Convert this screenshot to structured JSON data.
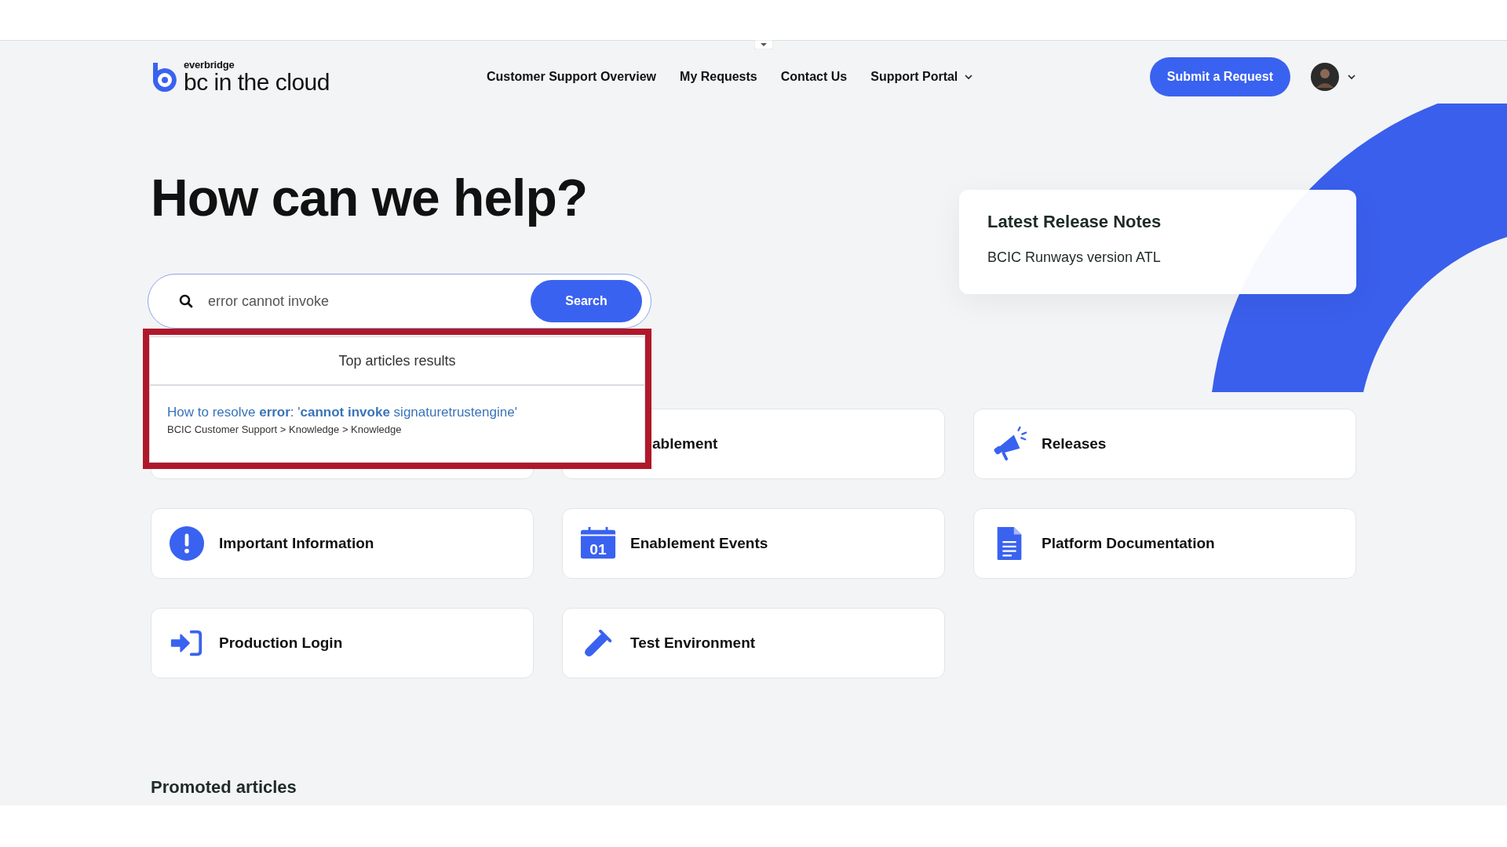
{
  "header": {
    "logo": {
      "brand": "everbridge",
      "name": "bc in the cloud"
    },
    "nav": [
      {
        "label": "Customer Support Overview",
        "dropdown": false
      },
      {
        "label": "My Requests",
        "dropdown": false
      },
      {
        "label": "Contact Us",
        "dropdown": false
      },
      {
        "label": "Support Portal",
        "dropdown": true
      }
    ],
    "cta": "Submit a Request"
  },
  "hero": {
    "heading": "How can we help?",
    "search": {
      "value": "error cannot invoke",
      "button": "Search"
    },
    "results": {
      "heading": "Top articles results",
      "items": [
        {
          "title": "How to resolve **error**: '**cannot invoke** signaturetrustengine'",
          "path": "BCIC Customer Support > Knowledge > Knowledge"
        }
      ]
    }
  },
  "release_notes": {
    "title": "Latest Release Notes",
    "items": [
      "BCIC Runways version ATL"
    ]
  },
  "cards": [
    {
      "kind": "covered"
    },
    {
      "kind": "partial",
      "label": "ablement"
    },
    {
      "kind": "full",
      "label": "Releases"
    },
    {
      "kind": "full",
      "label": "Important Information"
    },
    {
      "kind": "full",
      "label": "Enablement Events",
      "icon_text": "01"
    },
    {
      "kind": "full",
      "label": "Platform Documentation"
    },
    {
      "kind": "full",
      "label": "Production Login"
    },
    {
      "kind": "full",
      "label": "Test Environment"
    }
  ],
  "promoted": {
    "title": "Promoted articles"
  }
}
